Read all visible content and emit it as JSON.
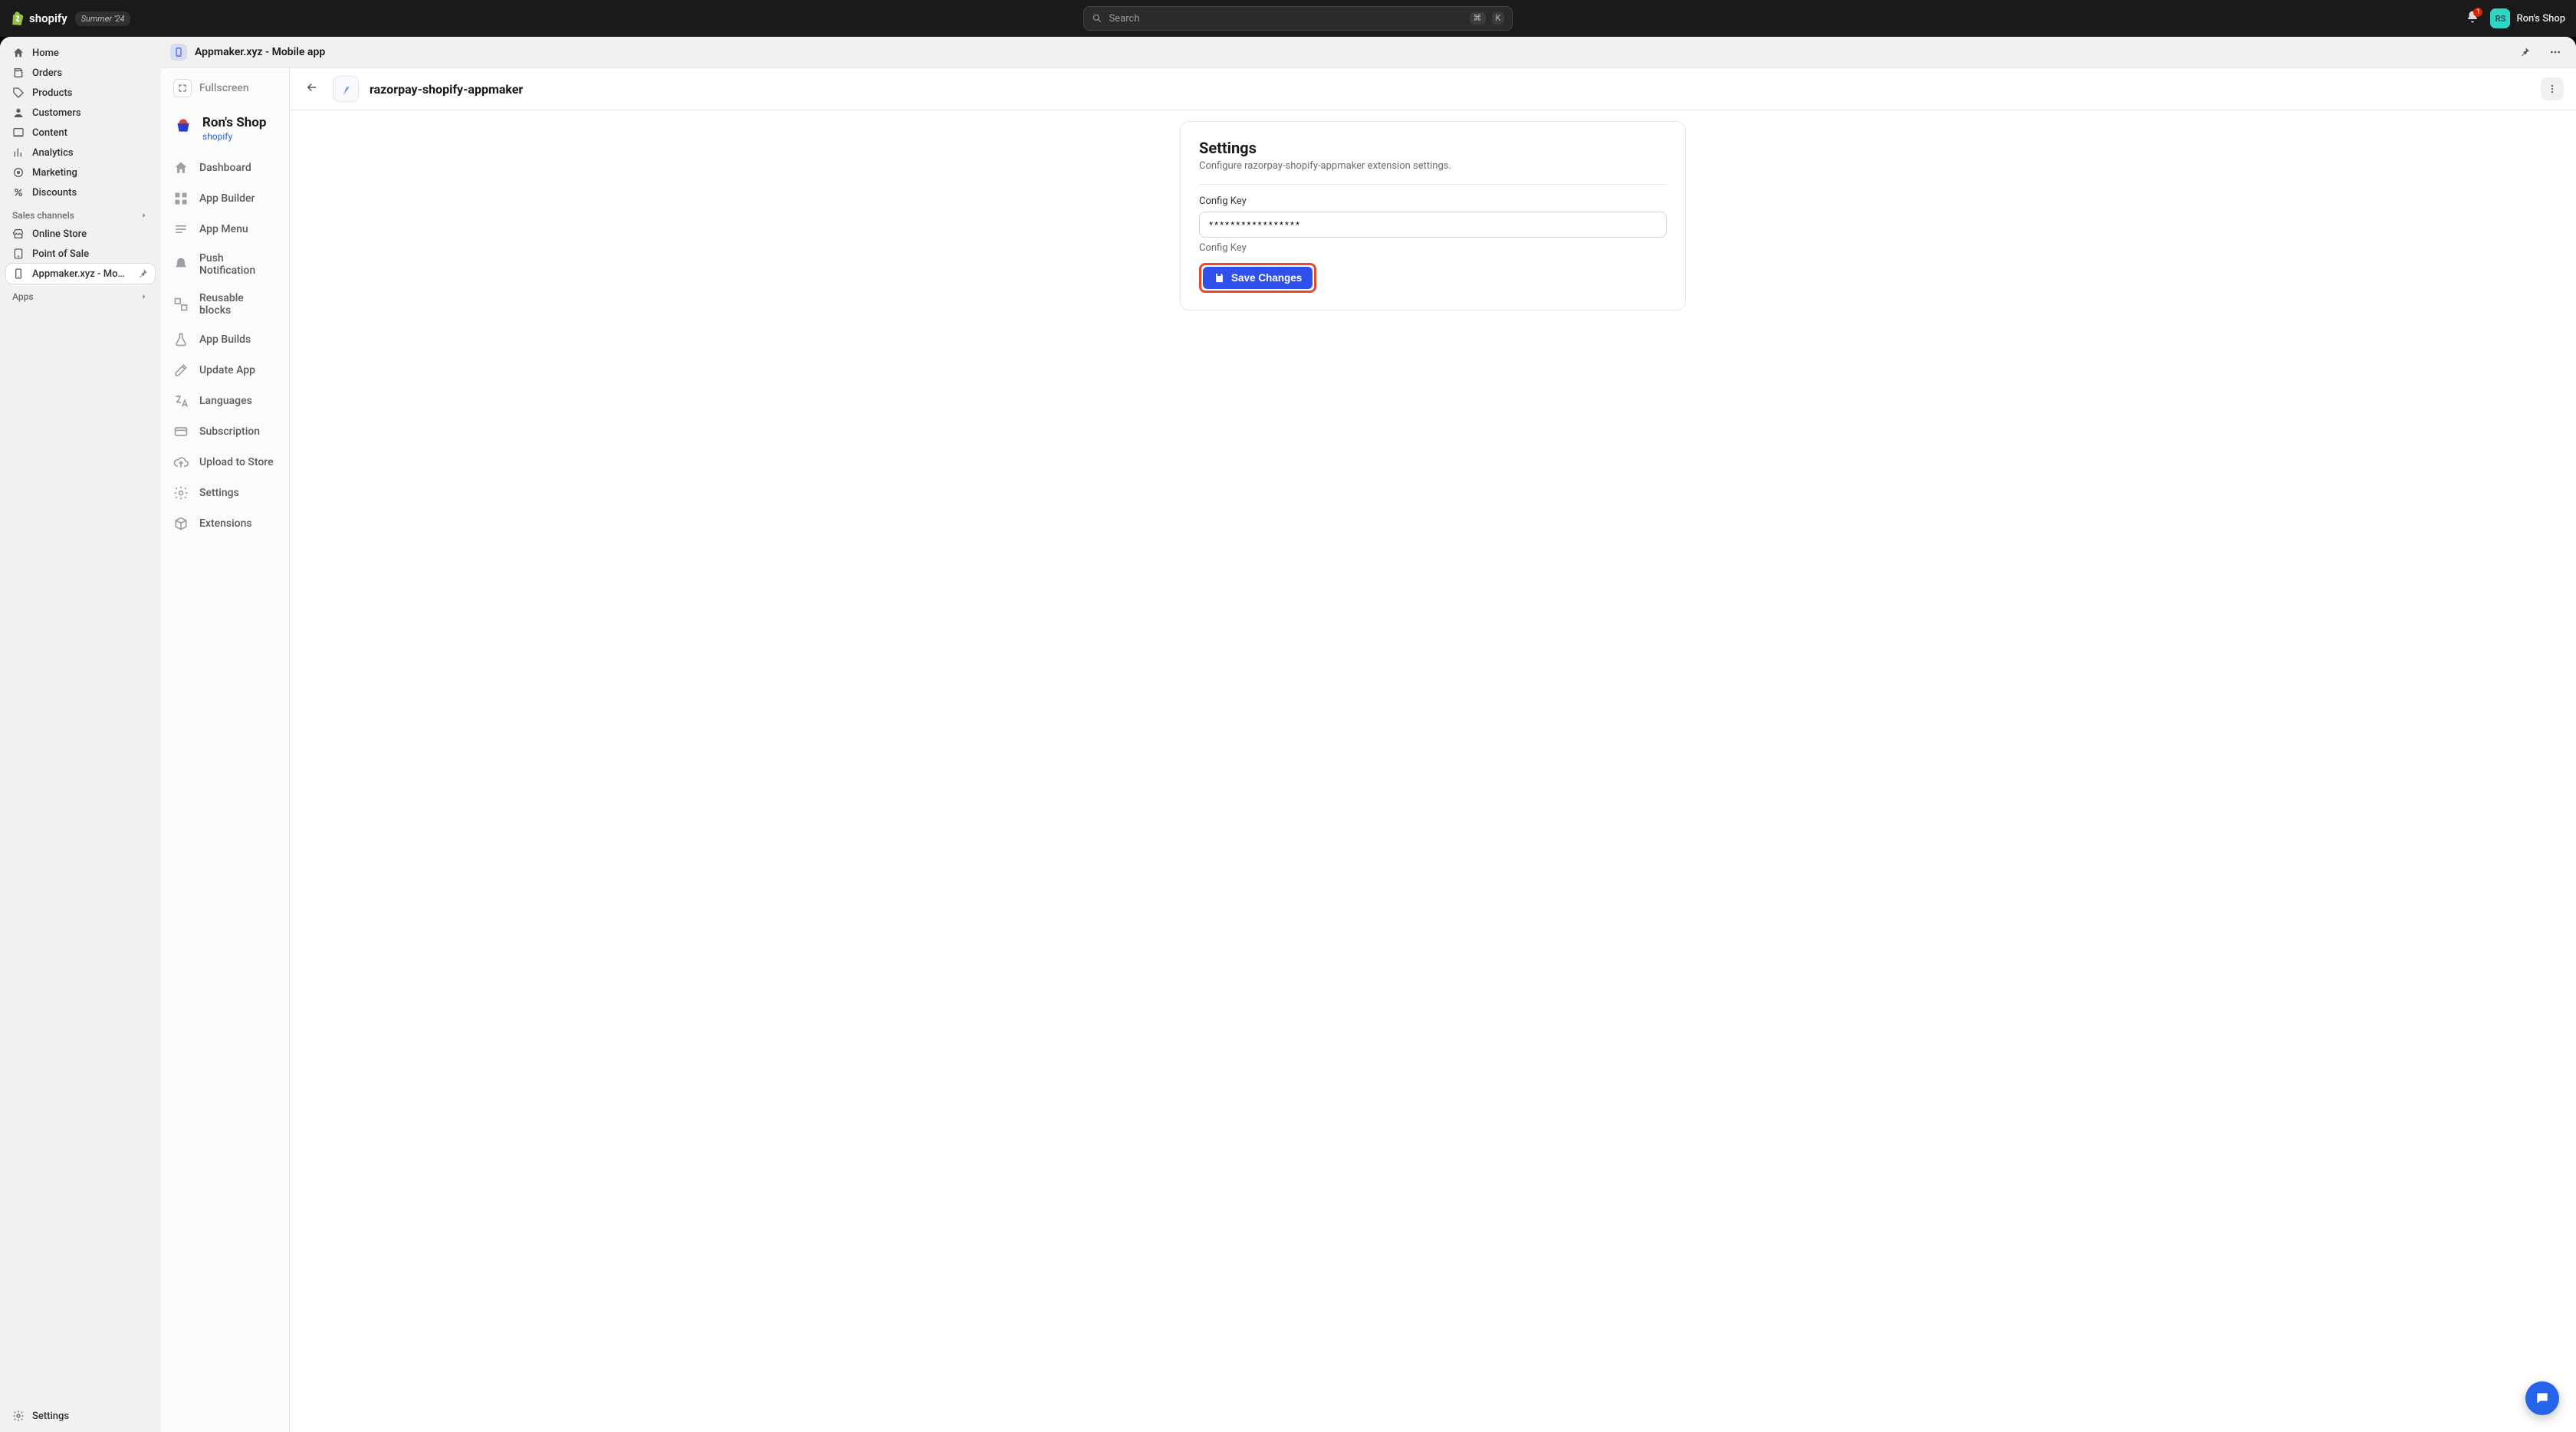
{
  "topbar": {
    "brand_text": "shopify",
    "pill": "Summer '24",
    "search_placeholder": "Search",
    "kbd1": "⌘",
    "kbd2": "K",
    "bell_count": "1",
    "avatar_initials": "RS",
    "account_name": "Ron's Shop"
  },
  "leftnav": {
    "items": [
      {
        "label": "Home"
      },
      {
        "label": "Orders"
      },
      {
        "label": "Products"
      },
      {
        "label": "Customers"
      },
      {
        "label": "Content"
      },
      {
        "label": "Analytics"
      },
      {
        "label": "Marketing"
      },
      {
        "label": "Discounts"
      }
    ],
    "sales_header": "Sales channels",
    "sales": [
      {
        "label": "Online Store"
      },
      {
        "label": "Point of Sale"
      },
      {
        "label": "Appmaker.xyz - Mobi..."
      }
    ],
    "apps_header": "Apps",
    "footer": "Settings"
  },
  "titlebar": {
    "app_name": "Appmaker.xyz - Mobile app"
  },
  "app_sidebar": {
    "fullscreen": "Fullscreen",
    "shop_name": "Ron's Shop",
    "shop_platform": "shopify",
    "items": [
      "Dashboard",
      "App Builder",
      "App Menu",
      "Push Notification",
      "Reusable blocks",
      "App Builds",
      "Update App",
      "Languages",
      "Subscription",
      "Upload to Store",
      "Settings",
      "Extensions"
    ]
  },
  "content": {
    "page_title": "razorpay-shopify-appmaker",
    "card_title": "Settings",
    "card_sub": "Configure razorpay-shopify-appmaker extension settings.",
    "field_label": "Config Key",
    "field_value": "*****************",
    "help": "Config Key",
    "save_label": "Save Changes"
  }
}
